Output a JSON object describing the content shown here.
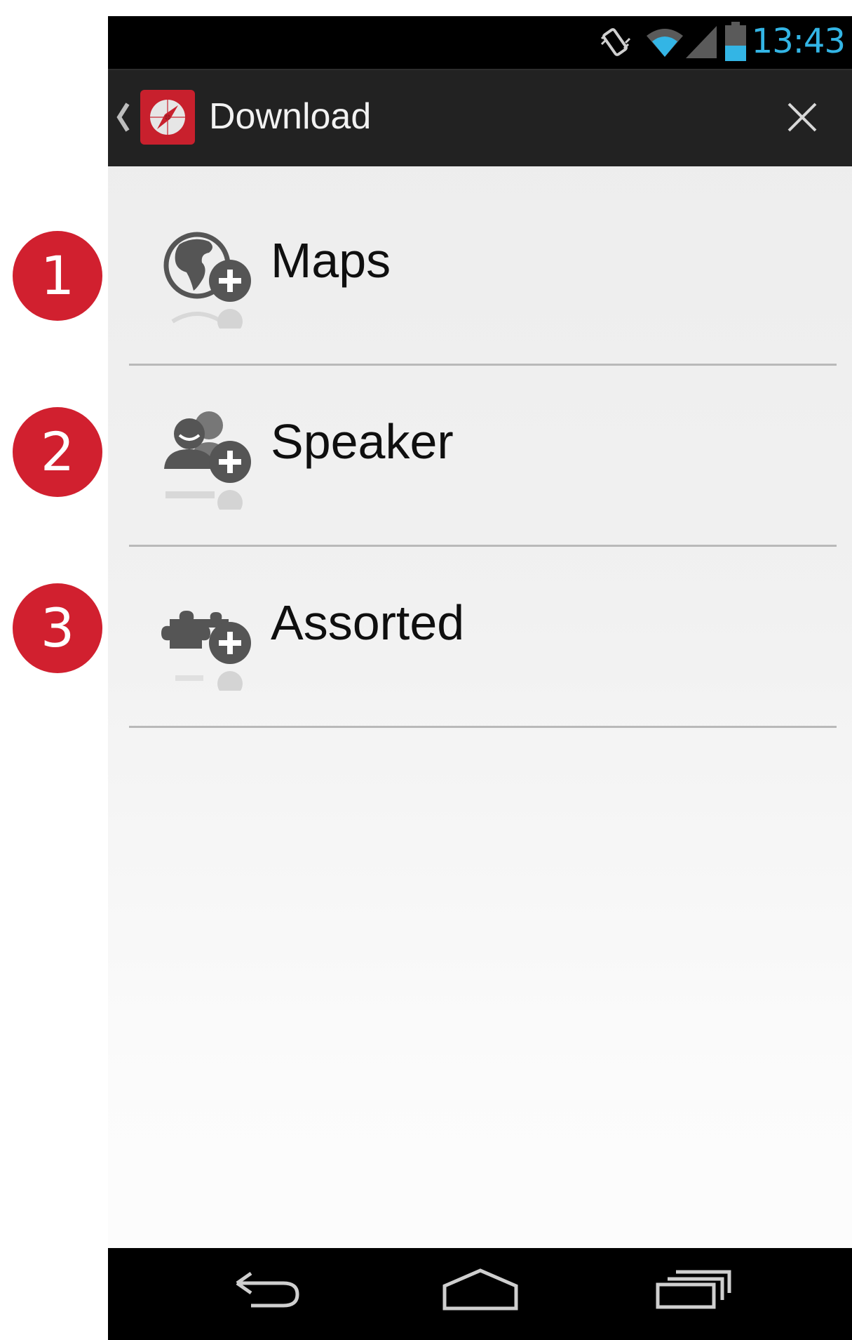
{
  "status_bar": {
    "time": "13:43",
    "icons": [
      "vibrate-icon",
      "wifi-icon",
      "signal-icon",
      "battery-icon"
    ],
    "clock_color": "#33b5e5"
  },
  "action_bar": {
    "title": "Download",
    "up_icon": "chevron-left-icon",
    "app_icon": "compass-logo-icon",
    "close_icon": "close-icon"
  },
  "list": {
    "items": [
      {
        "label": "Maps",
        "icon": "globe-add-icon"
      },
      {
        "label": "Speaker",
        "icon": "people-add-icon"
      },
      {
        "label": "Assorted",
        "icon": "puzzle-add-icon"
      }
    ]
  },
  "badges": [
    "1",
    "2",
    "3"
  ],
  "badge_color": "#d1202f",
  "nav_bar": {
    "buttons": [
      "back-icon",
      "home-icon",
      "recents-icon"
    ]
  }
}
